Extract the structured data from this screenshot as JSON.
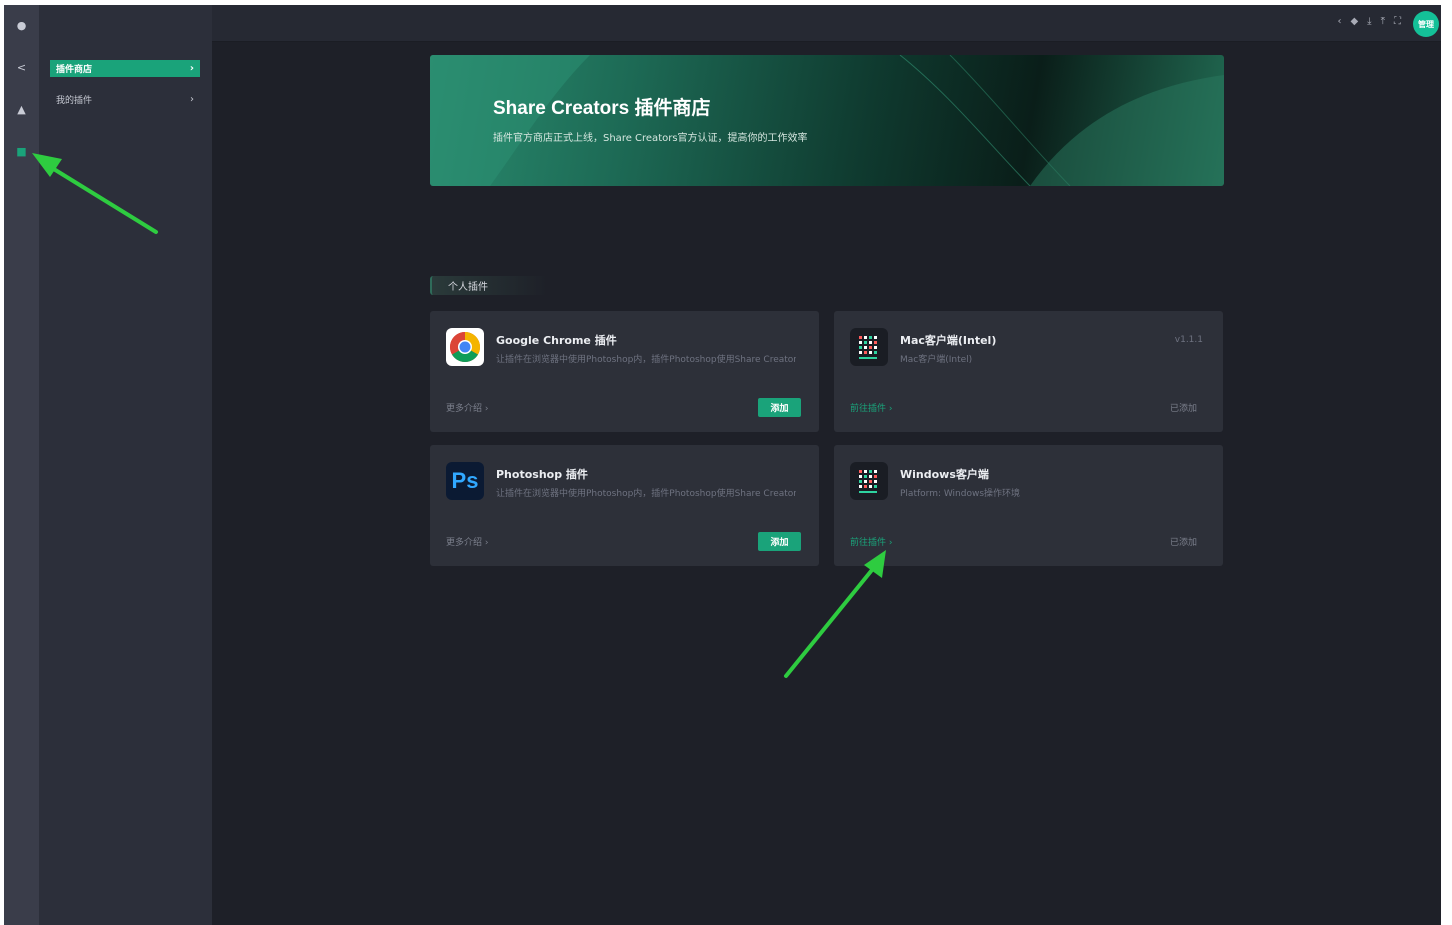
{
  "rail": {
    "items": [
      {
        "name": "rail-home-icon",
        "glyph": "●"
      },
      {
        "name": "rail-back-icon",
        "glyph": "<"
      },
      {
        "name": "rail-user-icon",
        "glyph": "▲"
      },
      {
        "name": "rail-plugin-icon",
        "glyph": "■"
      }
    ]
  },
  "subnav": {
    "items": [
      {
        "label": "插件商店",
        "active": true
      },
      {
        "label": "我的插件",
        "active": false
      }
    ],
    "chevron": "›"
  },
  "topbar": {
    "icons": [
      "‹",
      "◆",
      "⤓",
      "⤒",
      "⛶"
    ],
    "avatar": "管理"
  },
  "banner": {
    "title": "Share Creators 插件商店",
    "subtitle": "插件官方商店正式上线，Share Creators官方认证，提高你的工作效率"
  },
  "section": {
    "label": "个人插件"
  },
  "cards": [
    {
      "title": "Google Chrome 插件",
      "desc": "让插件在浏览器中使用Photoshop内，插件Photoshop使用Share Creators",
      "version": "",
      "link": "更多介绍 ›",
      "action": "添加",
      "icon": "chrome-icon"
    },
    {
      "title": "Mac客户端(Intel)",
      "desc": "Mac客户端(Intel)",
      "version": "v1.1.1",
      "link": "前往插件 ›",
      "action": "已添加",
      "icon": "app-grid-icon"
    },
    {
      "title": "Photoshop 插件",
      "desc": "让插件在浏览器中使用Photoshop内，插件Photoshop使用Share Creators",
      "version": "",
      "link": "更多介绍 ›",
      "action": "添加",
      "icon": "photoshop-icon"
    },
    {
      "title": "Windows客户端",
      "desc": "Platform: Windows操作环境",
      "version": "",
      "link": "前往插件 ›",
      "action": "已添加",
      "icon": "app-grid-icon"
    }
  ],
  "ps_icon_text": "Ps",
  "colors": {
    "accent": "#1aa37a",
    "background": "#1e2028",
    "card": "#2d3039",
    "annotation": "#2ecc40"
  }
}
